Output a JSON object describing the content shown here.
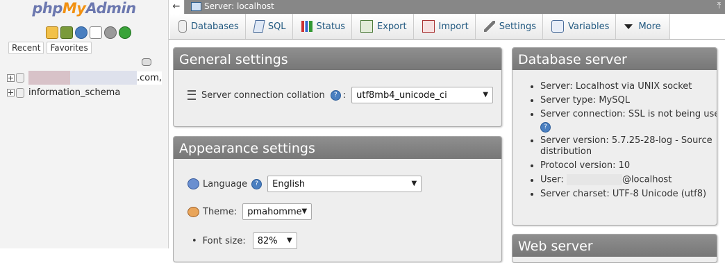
{
  "nav": {
    "logo": {
      "part1": "php",
      "part2": "My",
      "part3": "Admin"
    },
    "icons": [
      "home-icon",
      "exit-icon",
      "help-icon",
      "docs-icon",
      "settings-icon",
      "reload-icon"
    ],
    "tabs": [
      {
        "label": "Recent"
      },
      {
        "label": "Favorites"
      }
    ],
    "tree": [
      {
        "name": ".com,",
        "redacted": true
      },
      {
        "name": "information_schema",
        "redacted": false
      }
    ]
  },
  "topbar": {
    "back_icon": "←",
    "server_label": "Server: localhost",
    "up_icon": "⤒"
  },
  "tabs": [
    {
      "label": "Databases",
      "icon": "database-icon"
    },
    {
      "label": "SQL",
      "icon": "sql-icon"
    },
    {
      "label": "Status",
      "icon": "status-icon"
    },
    {
      "label": "Export",
      "icon": "export-icon"
    },
    {
      "label": "Import",
      "icon": "import-icon"
    },
    {
      "label": "Settings",
      "icon": "settings-icon"
    },
    {
      "label": "Variables",
      "icon": "variables-icon"
    },
    {
      "label": "More",
      "icon": "caret-down-icon"
    }
  ],
  "general": {
    "title": "General settings",
    "collation_label": "Server connection collation",
    "collation_value": "utf8mb4_unicode_ci"
  },
  "appearance": {
    "title": "Appearance settings",
    "language_label": "Language",
    "language_value": "English",
    "theme_label": "Theme:",
    "theme_value": "pmahomme",
    "fontsize_label": "Font size:",
    "fontsize_value": "82%"
  },
  "dbserver": {
    "title": "Database server",
    "items": [
      "Server: Localhost via UNIX socket",
      "Server type: MySQL",
      "Server connection: SSL is not being used",
      "Server version: 5.7.25-28-log - Source distribution",
      "Protocol version: 10",
      "@localhost",
      "Server charset: UTF-8 Unicode (utf8)"
    ],
    "user_prefix": "User:"
  },
  "webserver": {
    "title": "Web server"
  },
  "colors": {
    "topbar": "#878787",
    "panel_header": "#7f7f7f",
    "link": "#235a81",
    "arrow": "#e8333a"
  }
}
